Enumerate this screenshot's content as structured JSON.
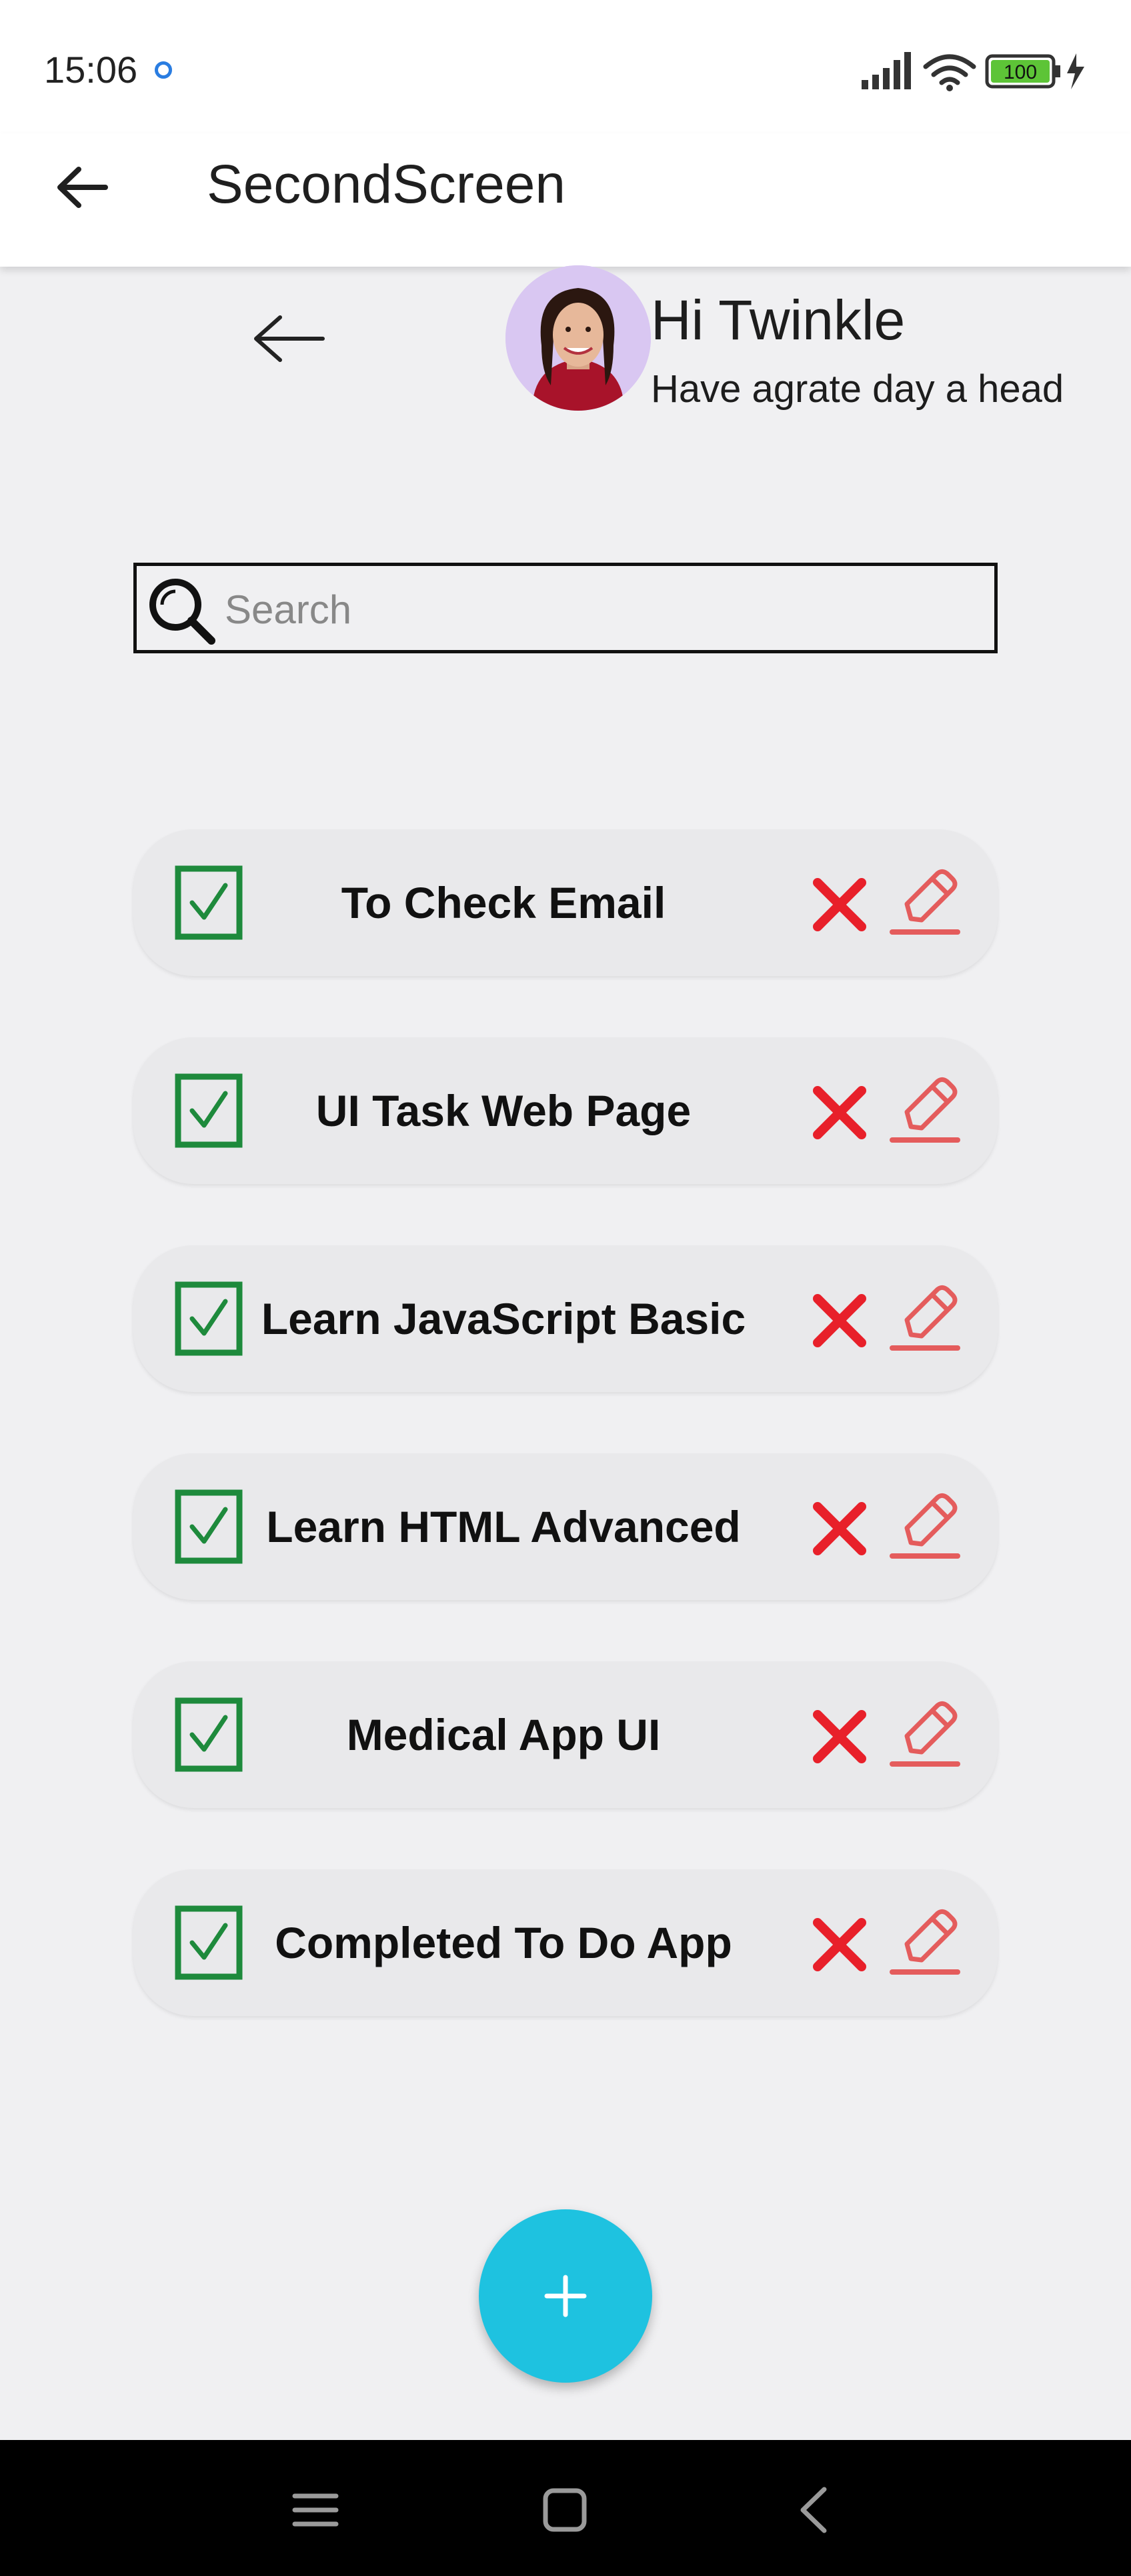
{
  "status_bar": {
    "time": "15:06",
    "battery": "100"
  },
  "app_bar": {
    "title": "SecondScreen"
  },
  "greeting": {
    "title": "Hi Twinkle",
    "subtitle": "Have agrate day a head"
  },
  "search": {
    "placeholder": "Search",
    "value": ""
  },
  "tasks": [
    {
      "label": "To Check Email",
      "checked": true
    },
    {
      "label": "UI Task Web Page",
      "checked": true
    },
    {
      "label": "Learn JavaScript Basic",
      "checked": true
    },
    {
      "label": "Learn HTML Advanced",
      "checked": true
    },
    {
      "label": "Medical App UI",
      "checked": true
    },
    {
      "label": "Completed To Do App",
      "checked": true
    }
  ],
  "icons": {
    "check": "checkbox-checked-icon",
    "delete": "close-icon",
    "edit": "pencil-icon",
    "add": "plus-icon"
  },
  "colors": {
    "check_green": "#1e8a3c",
    "delete_red": "#e8202a",
    "edit_red": "#e45c5c",
    "fab": "#1ec2e0",
    "background": "#f0f0f2"
  }
}
